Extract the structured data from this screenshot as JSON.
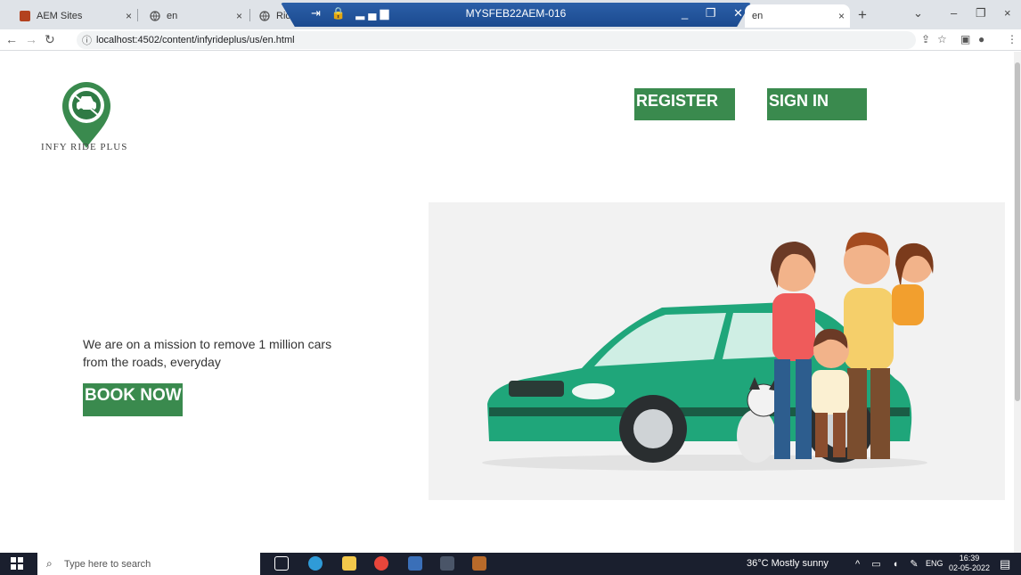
{
  "browser": {
    "tabs": [
      {
        "title": "AEM Sites",
        "close": "×"
      },
      {
        "title": "en",
        "close": "×"
      },
      {
        "title": "Ric",
        "close": "×"
      },
      {
        "title": "en",
        "close": "×"
      }
    ],
    "new_tab": "+",
    "remote_session_title": "MYSFEB22AEM-016",
    "url": "localhost:4502/content/infyrideplus/us/en.html",
    "window_controls": {
      "dropdown": "⌄",
      "minimize": "–",
      "restore": "❐",
      "close": "×"
    }
  },
  "page": {
    "brand": "INFY RIDE PLUS",
    "register_label": "REGISTER",
    "signin_label": "SIGN IN",
    "mission_line1": "We are on a mission to remove 1 million cars",
    "mission_line2": "from the roads, everyday",
    "book_label": "BOOK NOW"
  },
  "colors": {
    "accent": "#3a8a4e",
    "car": "#1fa67a",
    "hero_bg": "#f2f2f2"
  },
  "taskbar": {
    "search_placeholder": "Type here to search",
    "weather": "36°C  Mostly sunny",
    "language": "ENG",
    "time": "16:39",
    "date": "02-05-2022"
  }
}
